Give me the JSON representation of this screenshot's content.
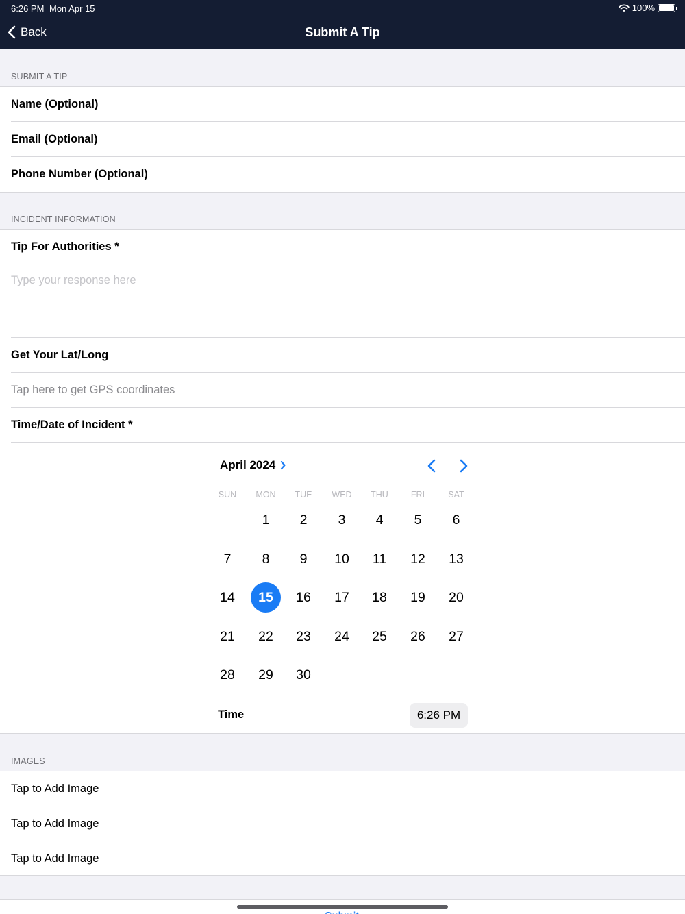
{
  "status_bar": {
    "time": "6:26 PM",
    "date": "Mon Apr 15",
    "battery": "100%"
  },
  "nav": {
    "back_label": "Back",
    "title": "Submit A Tip"
  },
  "section_submit": {
    "header": "SUBMIT A TIP",
    "rows": [
      "Name (Optional)",
      "Email (Optional)",
      "Phone Number (Optional)"
    ]
  },
  "section_incident": {
    "header": "INCIDENT INFORMATION",
    "tip_label": "Tip For Authorities *",
    "tip_placeholder": "Type your response here",
    "latlong_label": "Get Your Lat/Long",
    "gps_action": "Tap here to get GPS coordinates",
    "datetime_label": "Time/Date of Incident *"
  },
  "calendar": {
    "month_label": "April 2024",
    "weekdays": [
      "SUN",
      "MON",
      "TUE",
      "WED",
      "THU",
      "FRI",
      "SAT"
    ],
    "first_weekday_index": 1,
    "days_in_month": 30,
    "selected_day": 15,
    "accent_color": "#1a7cf5",
    "time_label": "Time",
    "time_value": "6:26 PM"
  },
  "section_images": {
    "header": "IMAGES",
    "rows": [
      "Tap to Add Image",
      "Tap to Add Image",
      "Tap to Add Image"
    ]
  },
  "colors": {
    "nav_background": "#141d33",
    "accent": "#1a7cf5",
    "grouped_background": "#f2f2f7"
  }
}
